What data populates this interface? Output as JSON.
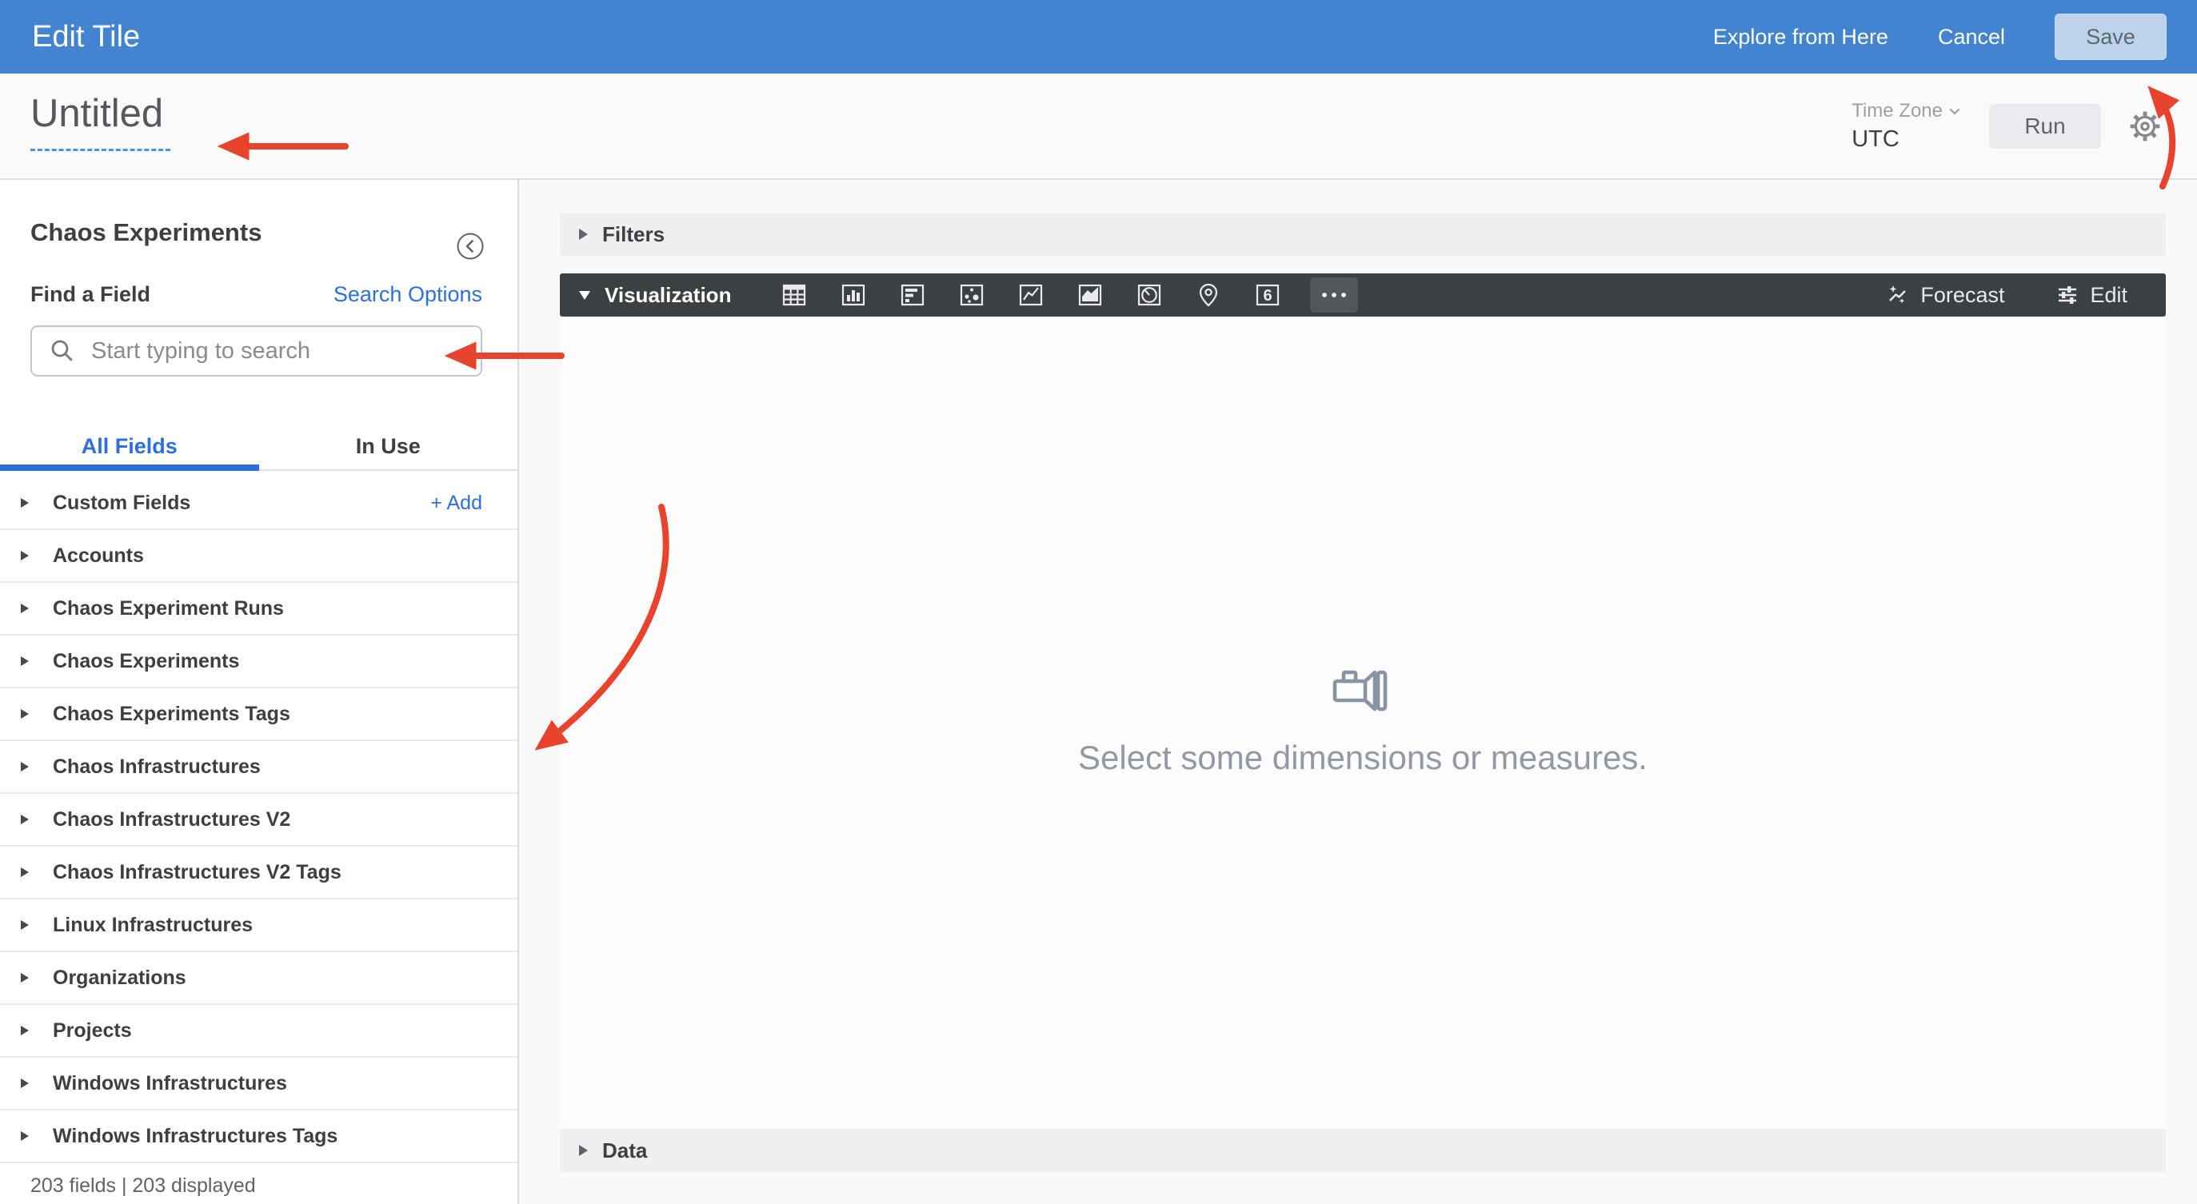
{
  "topbar": {
    "title": "Edit Tile",
    "explore_label": "Explore from Here",
    "cancel_label": "Cancel",
    "save_label": "Save"
  },
  "header": {
    "title": "Untitled",
    "timezone_label": "Time Zone",
    "timezone_value": "UTC",
    "run_label": "Run"
  },
  "sidebar": {
    "title": "Chaos Experiments",
    "collapse_icon": "chevron-left-circle-icon",
    "find_label": "Find a Field",
    "search_options_label": "Search Options",
    "search_icon": "search-icon",
    "search_placeholder": "Start typing to search",
    "tabs": [
      {
        "label": "All Fields",
        "active": true
      },
      {
        "label": "In Use",
        "active": false
      }
    ],
    "add_label": "+ Add",
    "groups": [
      {
        "label": "Custom Fields",
        "has_add": true
      },
      {
        "label": "Accounts"
      },
      {
        "label": "Chaos Experiment Runs"
      },
      {
        "label": "Chaos Experiments"
      },
      {
        "label": "Chaos Experiments Tags"
      },
      {
        "label": "Chaos Infrastructures"
      },
      {
        "label": "Chaos Infrastructures V2"
      },
      {
        "label": "Chaos Infrastructures V2 Tags"
      },
      {
        "label": "Linux Infrastructures"
      },
      {
        "label": "Organizations"
      },
      {
        "label": "Projects"
      },
      {
        "label": "Windows Infrastructures"
      },
      {
        "label": "Windows Infrastructures Tags"
      }
    ],
    "footer": "203 fields | 203 displayed"
  },
  "main": {
    "filters_label": "Filters",
    "visualization_label": "Visualization",
    "viz_icons": [
      "table-icon",
      "column-chart-icon",
      "bar-chart-icon",
      "scatterplot-icon",
      "line-chart-icon",
      "area-chart-icon",
      "pie-chart-icon",
      "map-icon",
      "single-value-icon",
      "more-icon"
    ],
    "forecast_label": "Forecast",
    "edit_label": "Edit",
    "empty_state_icon": "flashlight-icon",
    "empty_state": "Select some dimensions or measures.",
    "data_label": "Data"
  },
  "colors": {
    "topbar_blue": "#4384d1",
    "accent_blue": "#2e6fdd",
    "dark_bar": "#3d4043",
    "annotation_red": "#e8432c"
  }
}
